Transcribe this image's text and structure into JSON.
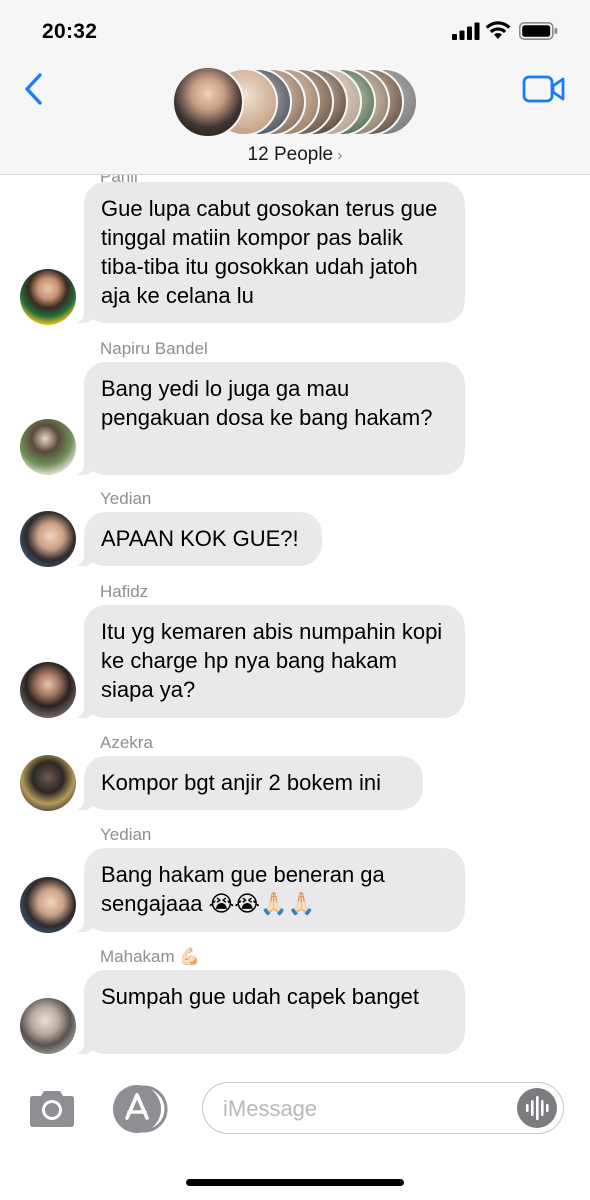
{
  "status_bar": {
    "time": "20:32"
  },
  "header": {
    "people_label": "12 People",
    "chevron": "›"
  },
  "messages": [
    {
      "sender": "Panji",
      "text": "Gue lupa cabut gosokan terus gue tinggal matiin kompor pas balik tiba-tiba itu gosokkan udah jatoh aja ke celana lu"
    },
    {
      "sender": "Napiru Bandel",
      "text": "Bang yedi lo juga ga mau pengakuan dosa ke bang hakam?"
    },
    {
      "sender": "Yedian",
      "text": "APAAN KOK GUE?!"
    },
    {
      "sender": "Hafidz",
      "text": "Itu yg kemaren abis numpahin kopi ke charge hp nya bang hakam siapa ya?"
    },
    {
      "sender": "Azekra",
      "text": "Kompor bgt anjir 2 bokem ini"
    },
    {
      "sender": "Yedian",
      "text": "Bang hakam gue beneran ga sengajaaa 😭😭🙏🏻🙏🏻"
    },
    {
      "sender": "Mahakam 💪🏻",
      "text": "Sumpah gue udah capek banget"
    }
  ],
  "input": {
    "placeholder": "iMessage"
  },
  "icons": {
    "back": "chevron-left-icon",
    "video": "video-camera-icon",
    "camera": "camera-icon",
    "apps": "app-store-icon",
    "audio": "audio-waveform-icon"
  },
  "colors": {
    "accent": "#1a7cf5",
    "bubble": "#e9e9eb",
    "sender": "#8e8e93"
  }
}
